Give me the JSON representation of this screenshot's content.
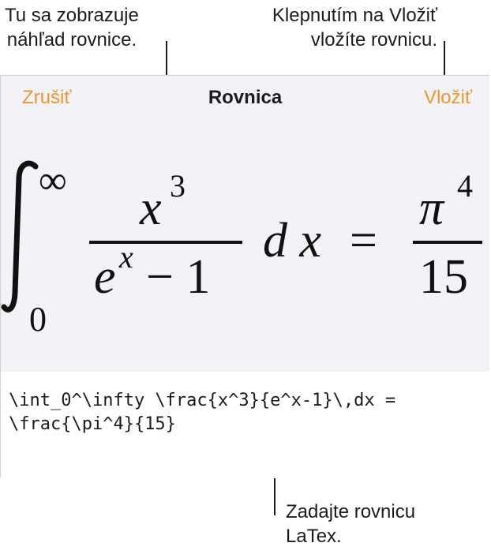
{
  "callouts": {
    "preview": [
      "Tu sa zobrazuje",
      "náhľad rovnice."
    ],
    "insert": [
      "Klepnutím na Vložiť",
      "vložíte rovnicu."
    ],
    "latex": [
      "Zadajte rovnicu",
      "LaTex."
    ]
  },
  "header": {
    "cancel_label": "Zrušiť",
    "title": "Rovnica",
    "insert_label": "Vložiť",
    "accent_color": "#f0962c"
  },
  "equation": {
    "integral_lower": "0",
    "integral_upper": "∞",
    "numerator_base": "x",
    "numerator_exp": "3",
    "denominator_base": "e",
    "denominator_exp": "x",
    "denominator_rest": "− 1",
    "differential": "d x",
    "equals": "=",
    "rhs_numerator_base": "π",
    "rhs_numerator_exp": "4",
    "rhs_denominator": "15"
  },
  "editor": {
    "latex_value": "\\int_0^\\infty \\frac{x^3}{e^x-1}\\,dx =\n\\frac{\\pi^4}{15}"
  }
}
